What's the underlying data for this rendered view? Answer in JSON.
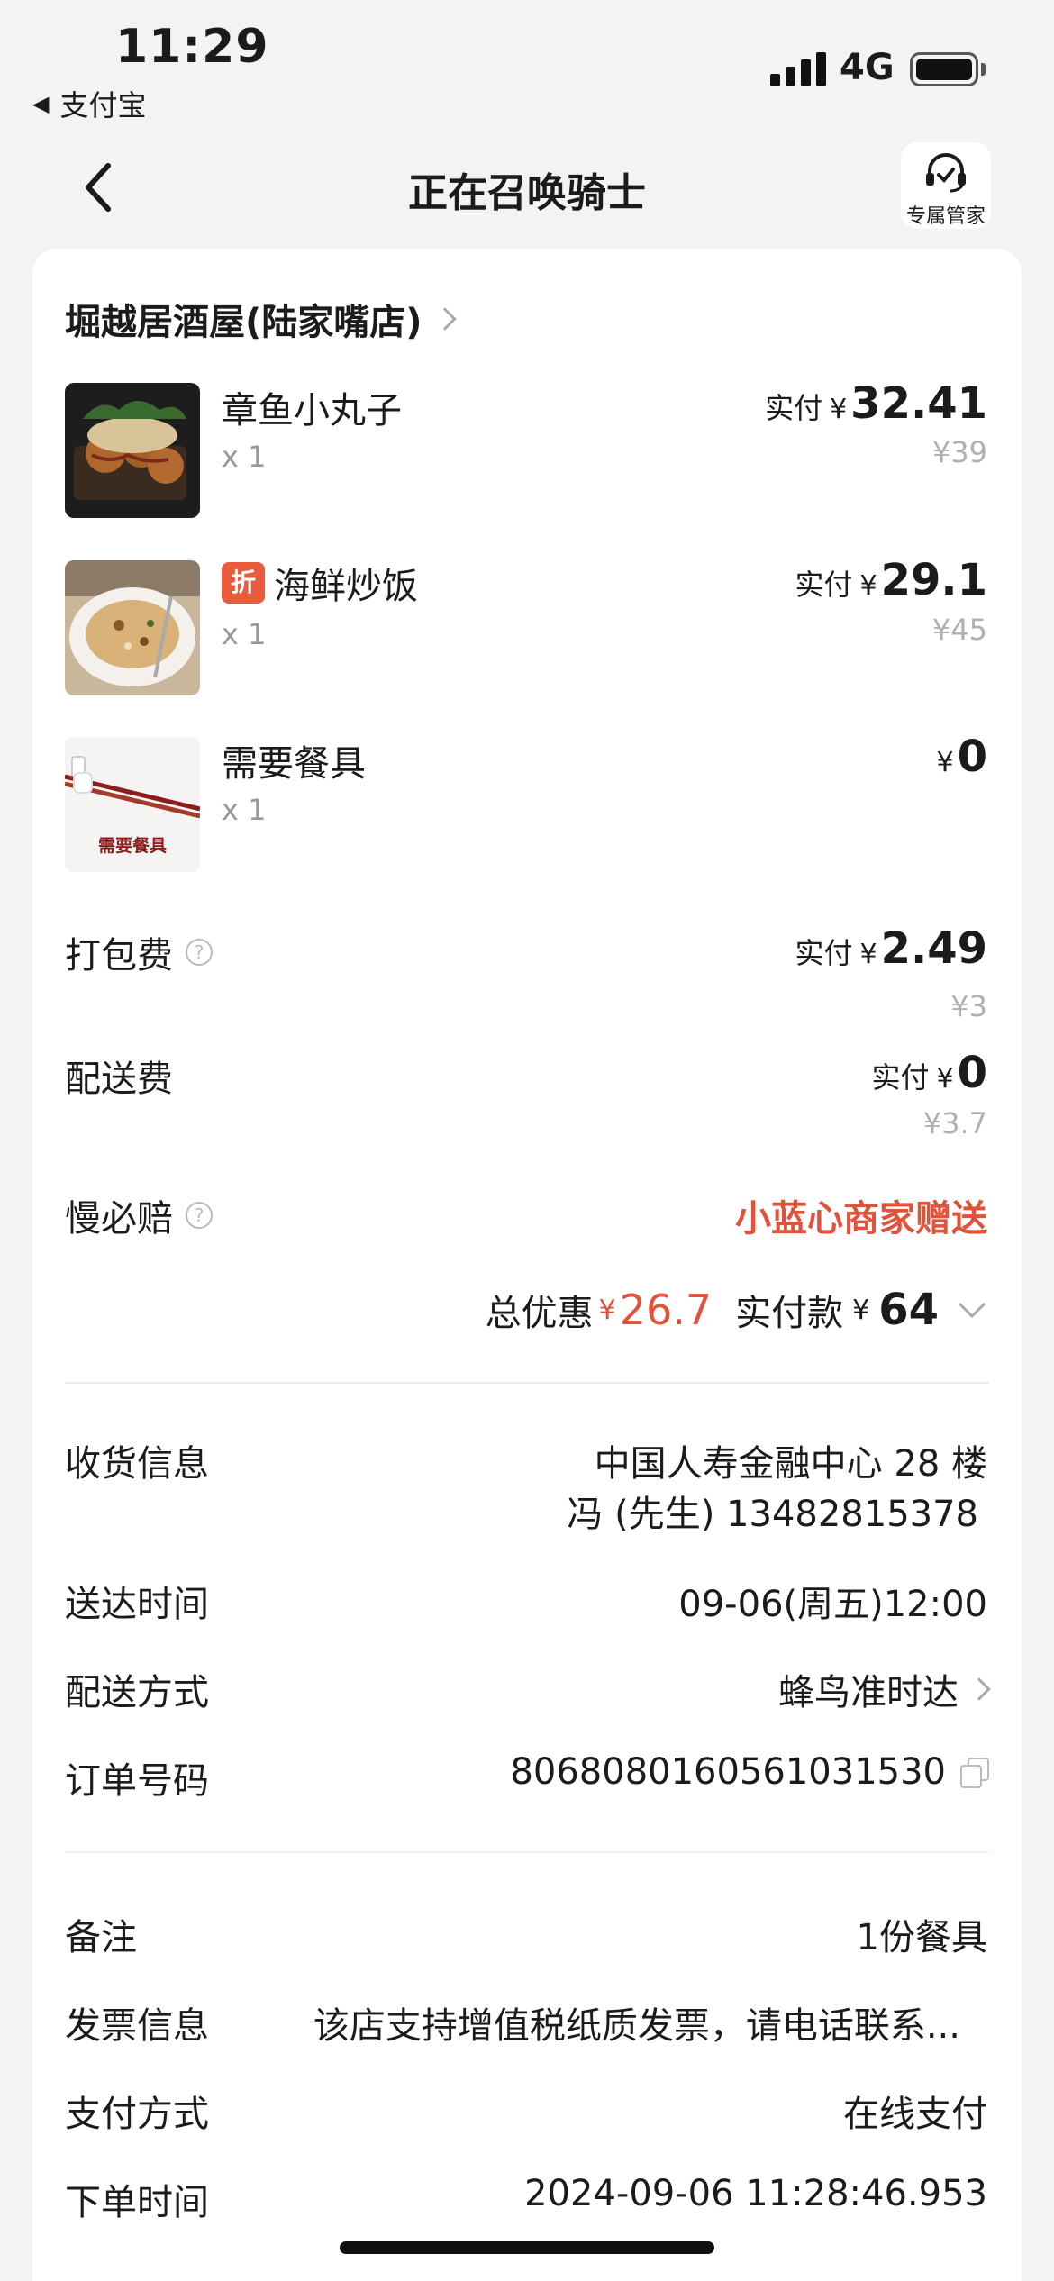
{
  "status_bar": {
    "time": "11:29",
    "back_app": "支付宝",
    "network": "4G"
  },
  "nav": {
    "title": "正在召唤骑士",
    "butler_label": "专属管家"
  },
  "shop": {
    "name": "堀越居酒屋(陆家嘴店)"
  },
  "items": [
    {
      "name": "章鱼小丸子",
      "qty": "x 1",
      "paid_label": "实付",
      "currency": "¥",
      "paid": "32.41",
      "original": "¥39"
    },
    {
      "badge": "折",
      "name": "海鲜炒饭",
      "qty": "x 1",
      "paid_label": "实付",
      "currency": "¥",
      "paid": "29.1",
      "original": "¥45"
    },
    {
      "name": "需要餐具",
      "qty": "x 1",
      "thumb_text": "需要餐具",
      "currency": "¥",
      "paid": "0"
    }
  ],
  "fees": {
    "packing": {
      "label": "打包费",
      "paid_label": "实付",
      "currency": "¥",
      "paid": "2.49",
      "original": "¥3"
    },
    "delivery": {
      "label": "配送费",
      "paid_label": "实付",
      "currency": "¥",
      "paid": "0",
      "original": "¥3.7"
    },
    "slow_compensation": {
      "label": "慢必赔",
      "value": "小蓝心商家赠送"
    }
  },
  "summary": {
    "discount_label": "总优惠",
    "discount_currency": "¥",
    "discount": "26.7",
    "paid_label": "实付款",
    "paid_currency": "¥",
    "paid": "64"
  },
  "info": {
    "address": {
      "label": "收货信息",
      "line1": "中国人寿金融中心 28 楼",
      "line2": "冯 (先生) 13482815378"
    },
    "delivery_time": {
      "label": "送达时间",
      "value": "09-06(周五)12:00"
    },
    "delivery_method": {
      "label": "配送方式",
      "value": "蜂鸟准时达"
    },
    "order_no": {
      "label": "订单号码",
      "value": "8068080160561031530"
    }
  },
  "extra": {
    "remark": {
      "label": "备注",
      "value": "1份餐具"
    },
    "invoice": {
      "label": "发票信息",
      "value": "该店支持增值税纸质发票，请电话联系..."
    },
    "payment": {
      "label": "支付方式",
      "value": "在线支付"
    },
    "order_time": {
      "label": "下单时间",
      "value": "2024-09-06 11:28:46.953"
    }
  },
  "colors": {
    "accent_red": "#e0533a",
    "badge_red": "#ea5a3c",
    "muted": "#b0b0b0",
    "background": "#f3f3f5"
  }
}
